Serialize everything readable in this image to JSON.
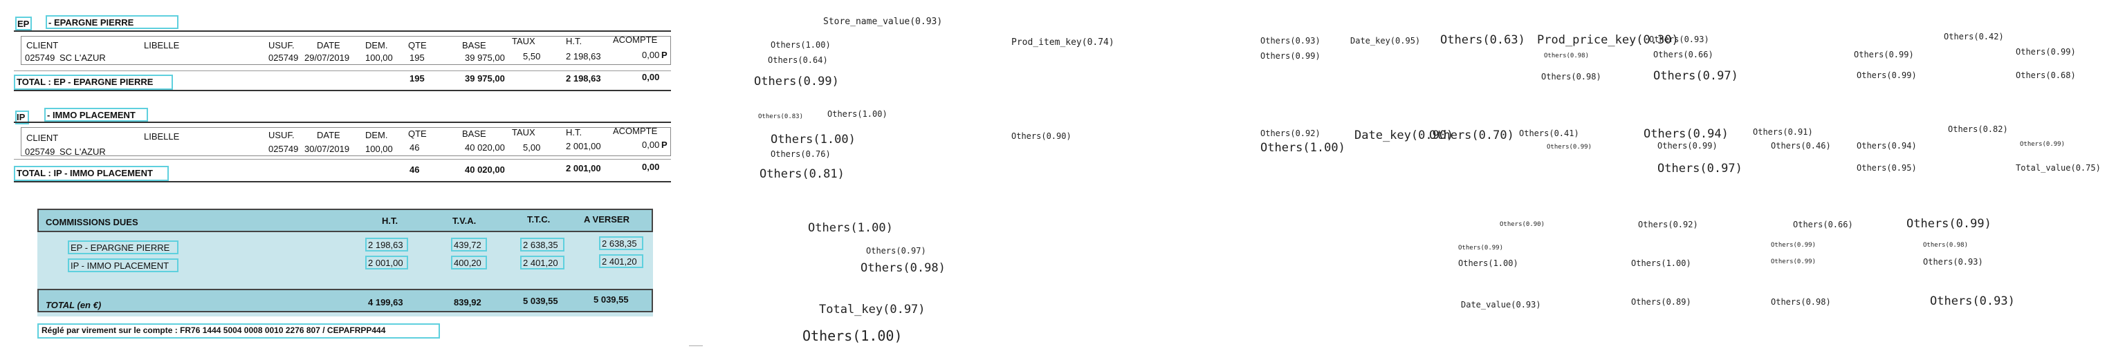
{
  "doc": {
    "ep": {
      "header": "EP",
      "title": "- EPARGNE PIERRE",
      "cols": [
        "CLIENT",
        "LIBELLE",
        "USUF.",
        "DATE",
        "DEM.",
        "QTE",
        "BASE",
        "TAUX",
        "H.T.",
        "ACOMPTE"
      ],
      "row": {
        "client": "025749",
        "libelle": "SC L'AZUR",
        "usuf": "025749",
        "date": "29/07/2019",
        "dem": "100,00",
        "qte": "195",
        "base": "39 975,00",
        "taux": "5,50",
        "ht": "2 198,63",
        "acompte": "0,00"
      },
      "marker": "P",
      "total_label": "TOTAL : EP - EPARGNE PIERRE",
      "total": {
        "qte": "195",
        "base": "39 975,00",
        "ht": "2 198,63",
        "acompte": "0,00"
      }
    },
    "ip": {
      "header": "IP",
      "title": "- IMMO PLACEMENT",
      "cols": [
        "CLIENT",
        "LIBELLE",
        "USUF.",
        "DATE",
        "DEM.",
        "QTE",
        "BASE",
        "TAUX",
        "H.T.",
        "ACOMPTE"
      ],
      "row": {
        "client": "025749",
        "libelle": "SC L'AZUR",
        "usuf": "025749",
        "date": "30/07/2019",
        "dem": "100,00",
        "qte": "46",
        "base": "40 020,00",
        "taux": "5,00",
        "ht": "2 001,00",
        "acompte": "0,00"
      },
      "marker": "P",
      "total_label": "TOTAL : IP - IMMO PLACEMENT",
      "total": {
        "qte": "46",
        "base": "40 020,00",
        "ht": "2 001,00",
        "acompte": "0,00"
      }
    },
    "commissions": {
      "title": "COMMISSIONS DUES",
      "cols": [
        "H.T.",
        "T.V.A.",
        "T.T.C.",
        "A VERSER"
      ],
      "rows": [
        {
          "label": "EP - EPARGNE PIERRE",
          "ht": "2 198,63",
          "tva": "439,72",
          "ttc": "2 638,35",
          "verser": "2 638,35"
        },
        {
          "label": "IP - IMMO PLACEMENT",
          "ht": "2 001,00",
          "tva": "400,20",
          "ttc": "2 401,20",
          "verser": "2 401,20"
        }
      ],
      "total_label": "TOTAL (en €)",
      "total": {
        "ht": "4 199,63",
        "tva": "839,92",
        "ttc": "5 039,55",
        "verser": "5 039,55"
      }
    },
    "payment": "Réglé par virement sur le compte : FR76 1444 5004 0008 0010 2276 807 / CEPAFRPP444"
  },
  "annotations": [
    "Store_name_value(0.93)",
    "Others(1.00)",
    "Others(0.64)",
    "Others(0.99)",
    "Prod_item_key(0.74)",
    "Others(0.93)",
    "Others(0.99)",
    "Date_key(0.95)",
    "Others(0.63)",
    "Prod_price_key(0.30)",
    "Others(0.93)",
    "Others(0.66)",
    "Others(0.97)",
    "Others(0.98)",
    "Others(0.98)",
    "Others(0.99)",
    "Others(0.99)",
    "Others(0.42)",
    "Others(0.99)",
    "Others(0.68)",
    "Others(0.83)",
    "Others(1.00)",
    "Others(1.00)",
    "Others(0.76)",
    "Others(0.81)",
    "Others(0.90)",
    "Others(0.92)",
    "Others(1.00)",
    "Date_key(0.90)",
    "Others(0.70)",
    "Others(0.41)",
    "Others(0.99)",
    "Others(0.94)",
    "Others(0.99)",
    "Others(0.97)",
    "Others(0.91)",
    "Others(0.46)",
    "Others(0.94)",
    "Others(0.95)",
    "Others(0.82)",
    "Others(0.99)",
    "Total_value(0.75)",
    "Others(1.00)",
    "Others(0.97)",
    "Others(0.98)",
    "Others(0.90)",
    "Others(0.99)",
    "Others(1.00)",
    "Others(0.92)",
    "Others(1.00)",
    "Others(0.66)",
    "Others(0.99)",
    "Others(0.99)",
    "Others(0.99)",
    "Others(0.98)",
    "Others(0.93)",
    "Total_key(0.97)",
    "Others(1.00)",
    "Date_value(0.93)",
    "Others(0.89)",
    "Others(0.98)",
    "Others(0.93)"
  ]
}
